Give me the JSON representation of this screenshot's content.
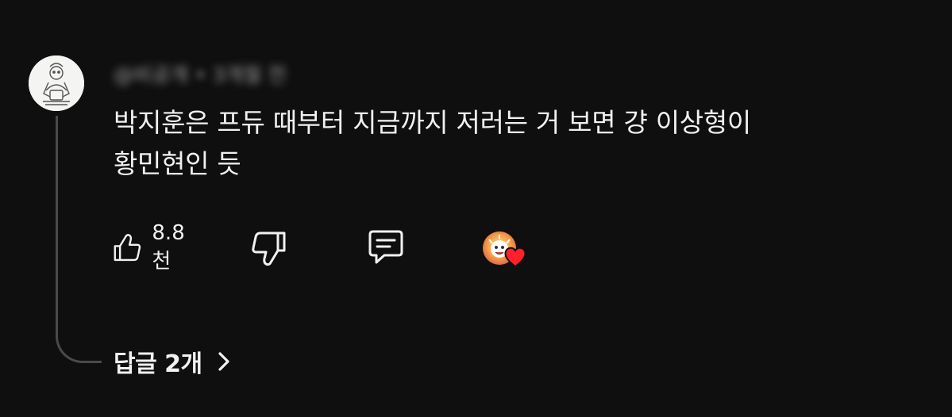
{
  "comment": {
    "author_meta": "@비공개 • 3개월 전",
    "text_line1": "박지훈은 프듀 때부터 지금까지 저러는 거 보면 걍 이상형이",
    "text_line2": "황민현인 듯",
    "avatar_icon": "cartoon-avatar",
    "meta_blurred": true
  },
  "actions": {
    "like_icon": "thumbs-up-icon",
    "like_count": "8.8천",
    "dislike_icon": "thumbs-down-icon",
    "reply_icon": "comment-icon",
    "creator_heart_icon": "creator-heart-icon",
    "heart_color": "#ff1f2d"
  },
  "replies": {
    "label": "답글 2개",
    "chevron_icon": "chevron-right-icon"
  },
  "theme": {
    "background": "#0f0f0f",
    "text": "#f1f1f1",
    "thread_line": "#4a4a4a"
  }
}
